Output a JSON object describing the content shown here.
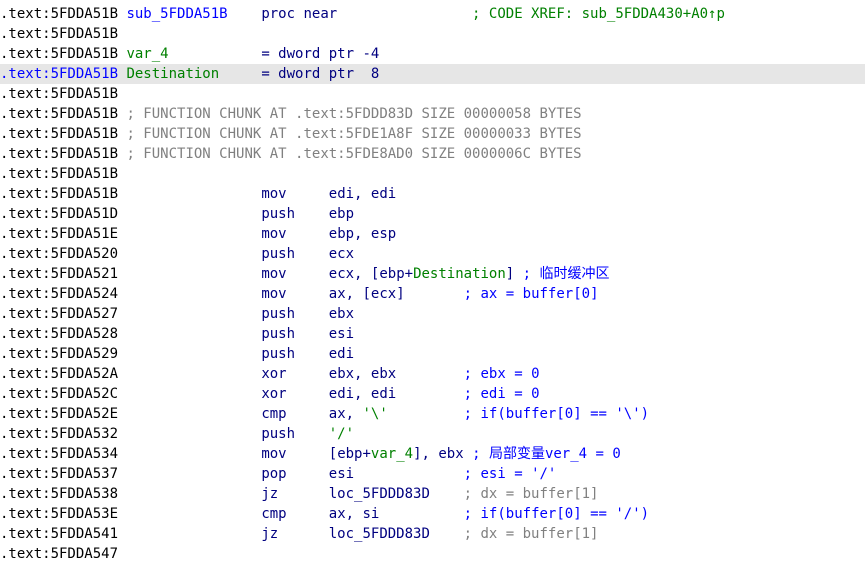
{
  "listing": {
    "lines": [
      [
        {
          "t": ".text:5FDDA51B",
          "c": "addr"
        },
        {
          "t": " ",
          "c": "addr"
        },
        {
          "t": "sub_5FDDA51B",
          "c": "name"
        },
        {
          "t": "    ",
          "c": "addr"
        },
        {
          "t": "proc near",
          "c": "kw"
        },
        {
          "t": "                ",
          "c": "addr"
        },
        {
          "t": "; CODE XREF: sub_5FDDA430+A0↑p",
          "c": "local"
        }
      ],
      [
        {
          "t": ".text:5FDDA51B",
          "c": "addr"
        }
      ],
      [
        {
          "t": ".text:5FDDA51B",
          "c": "addr"
        },
        {
          "t": " ",
          "c": "addr"
        },
        {
          "t": "var_4",
          "c": "local"
        },
        {
          "t": "           ",
          "c": "addr"
        },
        {
          "t": "= dword ptr -4",
          "c": "kw"
        }
      ],
      [
        {
          "t": ".text:5FDDA51B",
          "c": "name"
        },
        {
          "t": " ",
          "c": "addr"
        },
        {
          "t": "Destination",
          "c": "local"
        },
        {
          "t": "     ",
          "c": "addr"
        },
        {
          "t": "= dword ptr  8",
          "c": "kw"
        }
      ],
      [
        {
          "t": ".text:5FDDA51B",
          "c": "addr"
        }
      ],
      [
        {
          "t": ".text:5FDDA51B",
          "c": "addr"
        },
        {
          "t": " ",
          "c": "addr"
        },
        {
          "t": "; FUNCTION CHUNK AT .text:5FDDD83D SIZE 00000058 BYTES",
          "c": "gray"
        }
      ],
      [
        {
          "t": ".text:5FDDA51B",
          "c": "addr"
        },
        {
          "t": " ",
          "c": "addr"
        },
        {
          "t": "; FUNCTION CHUNK AT .text:5FDE1A8F SIZE 00000033 BYTES",
          "c": "gray"
        }
      ],
      [
        {
          "t": ".text:5FDDA51B",
          "c": "addr"
        },
        {
          "t": " ",
          "c": "addr"
        },
        {
          "t": "; FUNCTION CHUNK AT .text:5FDE8AD0 SIZE 0000006C BYTES",
          "c": "gray"
        }
      ],
      [
        {
          "t": ".text:5FDDA51B",
          "c": "addr"
        }
      ],
      [
        {
          "t": ".text:5FDDA51B",
          "c": "addr"
        },
        {
          "t": "                 ",
          "c": "addr"
        },
        {
          "t": "mov",
          "c": "kw"
        },
        {
          "t": "     ",
          "c": "addr"
        },
        {
          "t": "edi, edi",
          "c": "kw"
        }
      ],
      [
        {
          "t": ".text:5FDDA51D",
          "c": "addr"
        },
        {
          "t": "                 ",
          "c": "addr"
        },
        {
          "t": "push",
          "c": "kw"
        },
        {
          "t": "    ",
          "c": "addr"
        },
        {
          "t": "ebp",
          "c": "kw"
        }
      ],
      [
        {
          "t": ".text:5FDDA51E",
          "c": "addr"
        },
        {
          "t": "                 ",
          "c": "addr"
        },
        {
          "t": "mov",
          "c": "kw"
        },
        {
          "t": "     ",
          "c": "addr"
        },
        {
          "t": "ebp, esp",
          "c": "kw"
        }
      ],
      [
        {
          "t": ".text:5FDDA520",
          "c": "addr"
        },
        {
          "t": "                 ",
          "c": "addr"
        },
        {
          "t": "push",
          "c": "kw"
        },
        {
          "t": "    ",
          "c": "addr"
        },
        {
          "t": "ecx",
          "c": "kw"
        }
      ],
      [
        {
          "t": ".text:5FDDA521",
          "c": "addr"
        },
        {
          "t": "                 ",
          "c": "addr"
        },
        {
          "t": "mov",
          "c": "kw"
        },
        {
          "t": "     ",
          "c": "addr"
        },
        {
          "t": "ecx, [ebp+",
          "c": "kw"
        },
        {
          "t": "Destination",
          "c": "local"
        },
        {
          "t": "]",
          "c": "kw"
        },
        {
          "t": " ; 临时缓冲区",
          "c": "cmt"
        }
      ],
      [
        {
          "t": ".text:5FDDA524",
          "c": "addr"
        },
        {
          "t": "                 ",
          "c": "addr"
        },
        {
          "t": "mov",
          "c": "kw"
        },
        {
          "t": "     ",
          "c": "addr"
        },
        {
          "t": "ax, [ecx]",
          "c": "kw"
        },
        {
          "t": "       ",
          "c": "addr"
        },
        {
          "t": "; ax = buffer[0]",
          "c": "cmt"
        }
      ],
      [
        {
          "t": ".text:5FDDA527",
          "c": "addr"
        },
        {
          "t": "                 ",
          "c": "addr"
        },
        {
          "t": "push",
          "c": "kw"
        },
        {
          "t": "    ",
          "c": "addr"
        },
        {
          "t": "ebx",
          "c": "kw"
        }
      ],
      [
        {
          "t": ".text:5FDDA528",
          "c": "addr"
        },
        {
          "t": "                 ",
          "c": "addr"
        },
        {
          "t": "push",
          "c": "kw"
        },
        {
          "t": "    ",
          "c": "addr"
        },
        {
          "t": "esi",
          "c": "kw"
        }
      ],
      [
        {
          "t": ".text:5FDDA529",
          "c": "addr"
        },
        {
          "t": "                 ",
          "c": "addr"
        },
        {
          "t": "push",
          "c": "kw"
        },
        {
          "t": "    ",
          "c": "addr"
        },
        {
          "t": "edi",
          "c": "kw"
        }
      ],
      [
        {
          "t": ".text:5FDDA52A",
          "c": "addr"
        },
        {
          "t": "                 ",
          "c": "addr"
        },
        {
          "t": "xor",
          "c": "kw"
        },
        {
          "t": "     ",
          "c": "addr"
        },
        {
          "t": "ebx, ebx",
          "c": "kw"
        },
        {
          "t": "        ",
          "c": "addr"
        },
        {
          "t": "; ebx = 0",
          "c": "cmt"
        }
      ],
      [
        {
          "t": ".text:5FDDA52C",
          "c": "addr"
        },
        {
          "t": "                 ",
          "c": "addr"
        },
        {
          "t": "xor",
          "c": "kw"
        },
        {
          "t": "     ",
          "c": "addr"
        },
        {
          "t": "edi, edi",
          "c": "kw"
        },
        {
          "t": "        ",
          "c": "addr"
        },
        {
          "t": "; edi = 0",
          "c": "cmt"
        }
      ],
      [
        {
          "t": ".text:5FDDA52E",
          "c": "addr"
        },
        {
          "t": "                 ",
          "c": "addr"
        },
        {
          "t": "cmp",
          "c": "kw"
        },
        {
          "t": "     ",
          "c": "addr"
        },
        {
          "t": "ax, ",
          "c": "kw"
        },
        {
          "t": "'\\'",
          "c": "str"
        },
        {
          "t": "         ",
          "c": "addr"
        },
        {
          "t": "; if(buffer[0] == '\\')",
          "c": "cmt"
        }
      ],
      [
        {
          "t": ".text:5FDDA532",
          "c": "addr"
        },
        {
          "t": "                 ",
          "c": "addr"
        },
        {
          "t": "push",
          "c": "kw"
        },
        {
          "t": "    ",
          "c": "addr"
        },
        {
          "t": "'/'",
          "c": "str"
        }
      ],
      [
        {
          "t": ".text:5FDDA534",
          "c": "addr"
        },
        {
          "t": "                 ",
          "c": "addr"
        },
        {
          "t": "mov",
          "c": "kw"
        },
        {
          "t": "     ",
          "c": "addr"
        },
        {
          "t": "[ebp+",
          "c": "kw"
        },
        {
          "t": "var_4",
          "c": "local"
        },
        {
          "t": "], ebx",
          "c": "kw"
        },
        {
          "t": " ; 局部变量ver_4 = 0",
          "c": "cmt"
        }
      ],
      [
        {
          "t": ".text:5FDDA537",
          "c": "addr"
        },
        {
          "t": "                 ",
          "c": "addr"
        },
        {
          "t": "pop",
          "c": "kw"
        },
        {
          "t": "     ",
          "c": "addr"
        },
        {
          "t": "esi",
          "c": "kw"
        },
        {
          "t": "             ",
          "c": "addr"
        },
        {
          "t": "; esi = '/'",
          "c": "cmt"
        }
      ],
      [
        {
          "t": ".text:5FDDA538",
          "c": "addr"
        },
        {
          "t": "                 ",
          "c": "addr"
        },
        {
          "t": "jz",
          "c": "kw"
        },
        {
          "t": "      ",
          "c": "addr"
        },
        {
          "t": "loc_5FDDD83D",
          "c": "kw"
        },
        {
          "t": "    ",
          "c": "addr"
        },
        {
          "t": "; dx = buffer[1]",
          "c": "dcmt"
        }
      ],
      [
        {
          "t": ".text:5FDDA53E",
          "c": "addr"
        },
        {
          "t": "                 ",
          "c": "addr"
        },
        {
          "t": "cmp",
          "c": "kw"
        },
        {
          "t": "     ",
          "c": "addr"
        },
        {
          "t": "ax, si",
          "c": "kw"
        },
        {
          "t": "          ",
          "c": "addr"
        },
        {
          "t": "; if(buffer[0] == '/')",
          "c": "cmt"
        }
      ],
      [
        {
          "t": ".text:5FDDA541",
          "c": "addr"
        },
        {
          "t": "                 ",
          "c": "addr"
        },
        {
          "t": "jz",
          "c": "kw"
        },
        {
          "t": "      ",
          "c": "addr"
        },
        {
          "t": "loc_5FDDD83D",
          "c": "kw"
        },
        {
          "t": "    ",
          "c": "addr"
        },
        {
          "t": "; dx = buffer[1]",
          "c": "dcmt"
        }
      ],
      [
        {
          "t": ".text:5FDDA547",
          "c": "addr"
        }
      ]
    ],
    "highlighted_line": 3
  }
}
